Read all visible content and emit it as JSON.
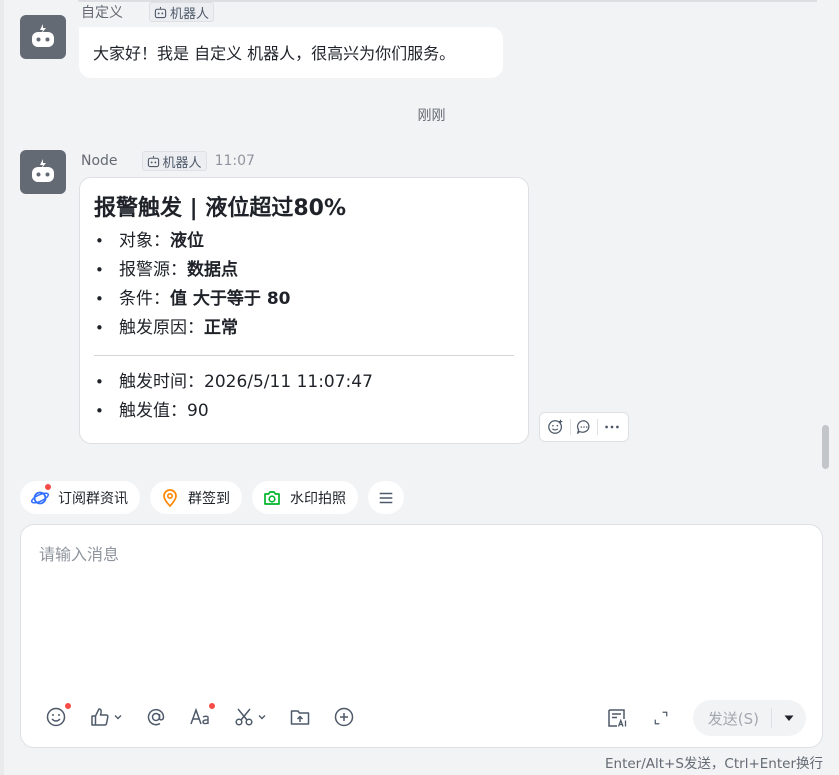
{
  "messages": [
    {
      "sender": "自定义",
      "tag": "机器人",
      "text": "大家好！我是 自定义 机器人，很高兴为你们服务。"
    }
  ],
  "divider_time": "刚刚",
  "alert_message": {
    "sender": "Node",
    "tag": "机器人",
    "time": "11:07",
    "card": {
      "title": "报警触发 | 液位超过80%",
      "fields": [
        {
          "label": "对象：",
          "value": "液位"
        },
        {
          "label": "报警源：",
          "value": "数据点"
        },
        {
          "label": "条件：",
          "value": "值 大于等于 80"
        },
        {
          "label": "触发原因：",
          "value": "正常"
        }
      ],
      "details": [
        {
          "label": "触发时间：",
          "value": "2026/5/11 11:07:47"
        },
        {
          "label": "触发值：",
          "value": "90"
        }
      ]
    }
  },
  "reaction_bar": {
    "icons": [
      "add-reaction-icon",
      "reply-icon",
      "more-icon"
    ]
  },
  "quick_actions": [
    {
      "label": "订阅群资讯",
      "icon": "planet-icon",
      "badge": true
    },
    {
      "label": "群签到",
      "icon": "location-pin-icon",
      "badge": false
    },
    {
      "label": "水印拍照",
      "icon": "camera-icon",
      "badge": false
    }
  ],
  "composer": {
    "placeholder": "请输入消息",
    "send_label": "发送(S)",
    "hint": "Enter/Alt+S发送，Ctrl+Enter换行"
  },
  "colors": {
    "background": "#f2f3f5",
    "badge_red": "#f54a45",
    "avatar_gray": "#646a73",
    "planet_blue": "#3370ff",
    "checkin_orange": "#ff8800",
    "camera_green": "#00b42a"
  }
}
